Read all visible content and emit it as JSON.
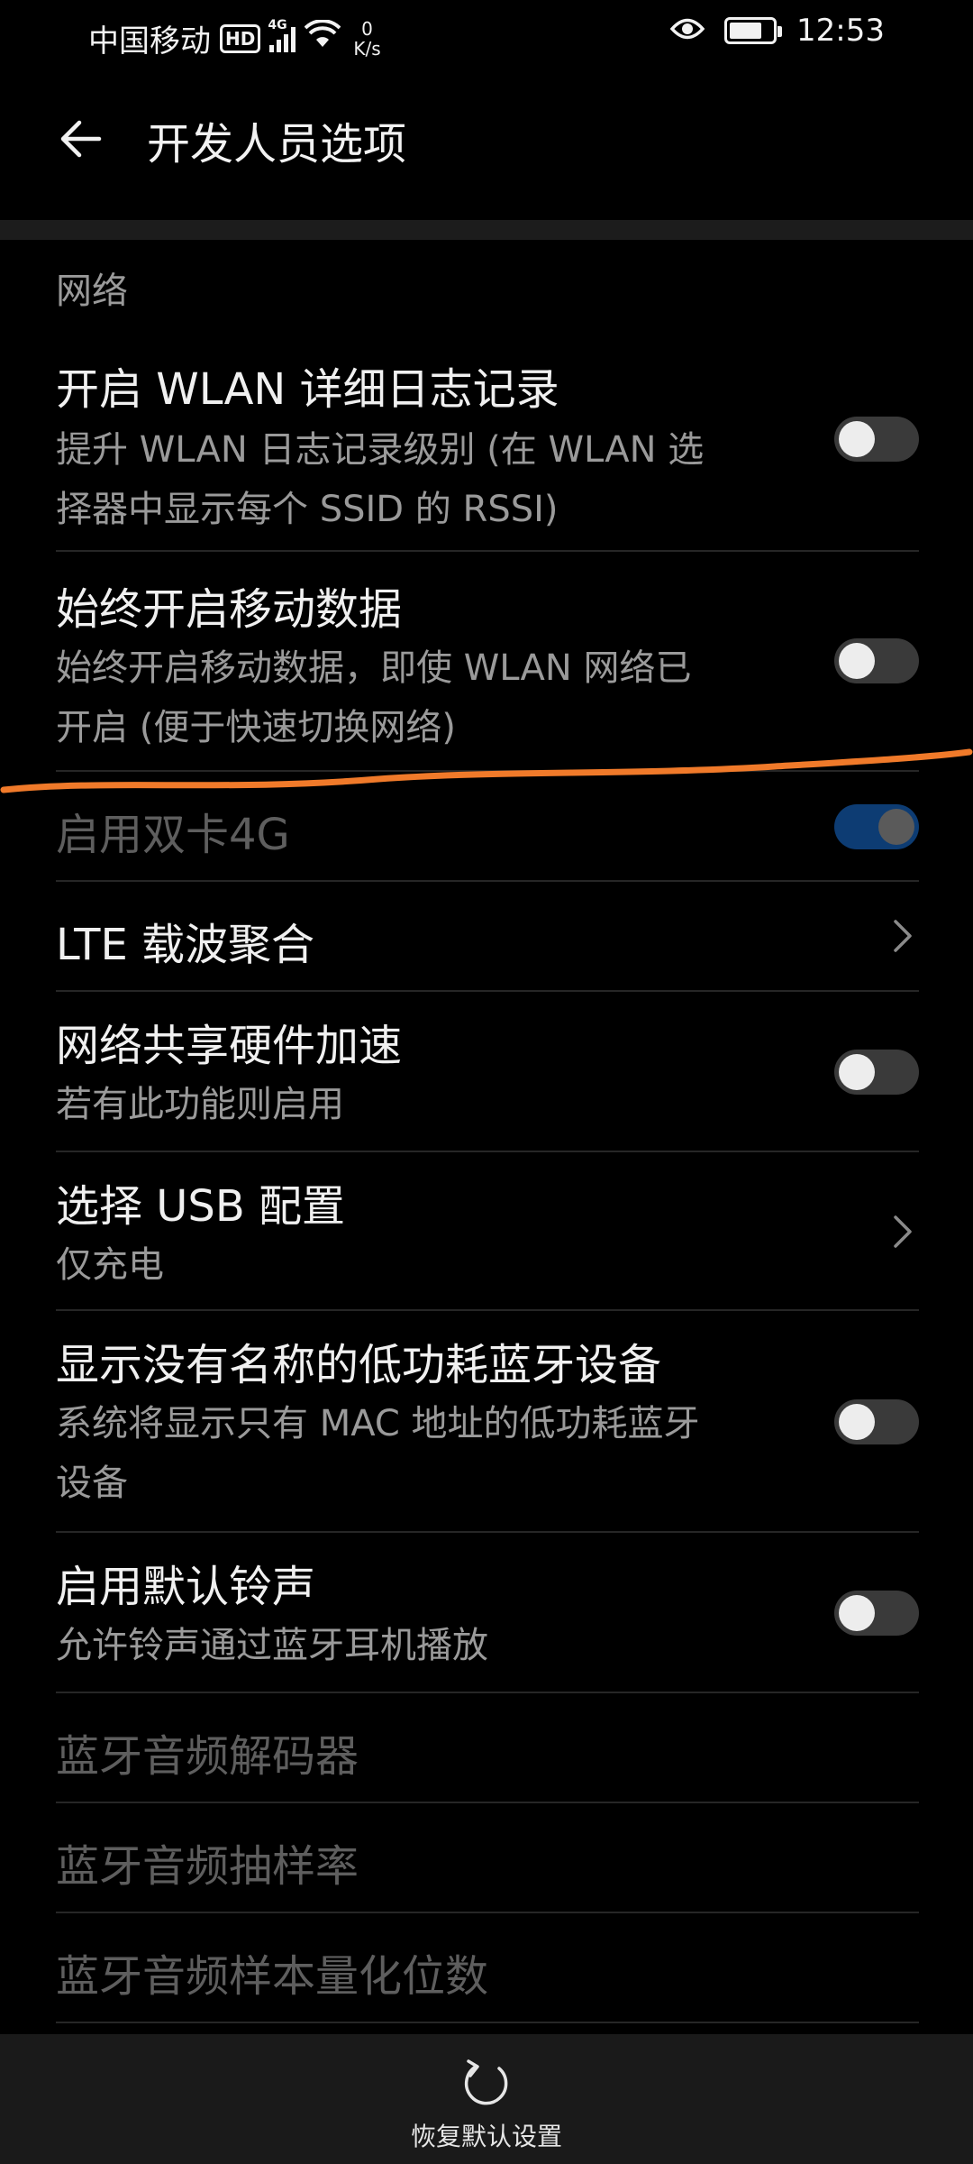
{
  "status_bar": {
    "carrier": "中国移动",
    "hd_badge": "HD",
    "network_type": "4G",
    "speed_value": "0",
    "speed_unit": "K/s",
    "time": "12:53",
    "icons": [
      "hd-icon",
      "signal-icon",
      "wifi-icon",
      "eye-icon",
      "battery-icon"
    ]
  },
  "app_bar": {
    "title": "开发人员选项",
    "back_icon": "arrow-left-icon"
  },
  "section": {
    "header": "网络"
  },
  "rows": [
    {
      "title": "开启 WLAN 详细日志记录",
      "subtitle_line1": "提升 WLAN 日志记录级别 (在 WLAN 选",
      "subtitle_line2": "择器中显示每个 SSID 的 RSSI)",
      "control": "toggle",
      "checked": false
    },
    {
      "title": "始终开启移动数据",
      "subtitle_line1": "始终开启移动数据，即使 WLAN 网络已",
      "subtitle_line2": "开启 (便于快速切换网络)",
      "control": "toggle",
      "checked": false
    },
    {
      "title": "启用双卡4G",
      "control": "toggle",
      "checked": true,
      "enabled": false
    },
    {
      "title": "LTE 载波聚合",
      "control": "chevron"
    },
    {
      "title": "网络共享硬件加速",
      "subtitle_line1": "若有此功能则启用",
      "control": "toggle",
      "checked": false
    },
    {
      "title": "选择 USB 配置",
      "subtitle_line1": "仅充电",
      "control": "chevron"
    },
    {
      "title": "显示没有名称的低功耗蓝牙设备",
      "subtitle_line1": "系统将显示只有 MAC 地址的低功耗蓝牙",
      "subtitle_line2": "设备",
      "control": "toggle",
      "checked": false
    },
    {
      "title": "启用默认铃声",
      "subtitle_line1": "允许铃声通过蓝牙耳机播放",
      "control": "toggle",
      "checked": false
    },
    {
      "title": "蓝牙音频解码器",
      "enabled": false
    },
    {
      "title": "蓝牙音频抽样率",
      "enabled": false
    },
    {
      "title": "蓝牙音频样本量化位数",
      "enabled": false
    }
  ],
  "bottom_bar": {
    "reset_label": "恢复默认设置",
    "reset_icon": "reset-icon"
  },
  "colors": {
    "background": "#000000",
    "annotation_stroke": "#f07a2a",
    "toggle_on": "#0d3c73"
  }
}
